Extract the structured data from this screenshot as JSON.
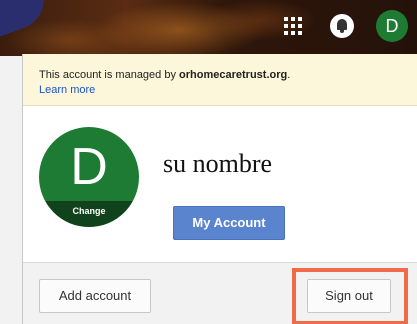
{
  "header": {
    "apps_icon": "apps-grid-icon",
    "notifications_icon": "bell-icon",
    "avatar_letter": "D"
  },
  "popup": {
    "notice": {
      "text_prefix": "This account is managed by ",
      "domain": "orhomecaretrust.org",
      "text_suffix": ".",
      "learn_more": "Learn more"
    },
    "profile": {
      "avatar_letter": "D",
      "change_label": "Change",
      "name": "su nombre",
      "my_account_label": "My Account"
    },
    "footer": {
      "add_account_label": "Add account",
      "sign_out_label": "Sign out"
    }
  },
  "colors": {
    "avatar": "#1e7b34",
    "primary_button": "#5b84cf",
    "notice_bg": "#fcf6da",
    "highlight": "#ef6b4a",
    "link": "#1a55c9"
  }
}
